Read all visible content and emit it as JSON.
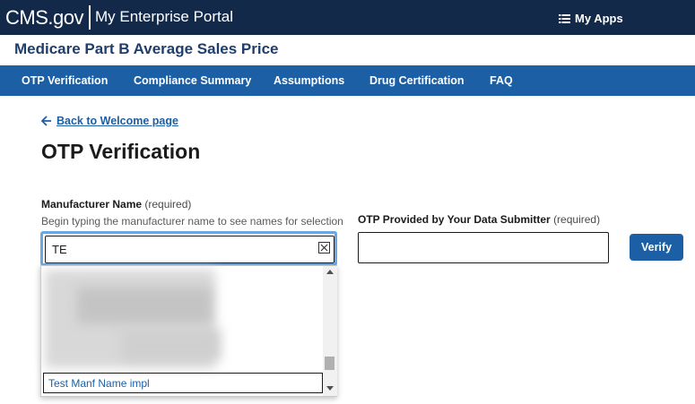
{
  "header": {
    "brand": "CMS.gov",
    "portal": "My Enterprise Portal",
    "my_apps": "My Apps",
    "my_apps_icon": "list-icon"
  },
  "app_title": "Medicare Part B Average Sales Price",
  "nav": {
    "items": [
      {
        "label": "OTP Verification"
      },
      {
        "label": "Compliance Summary"
      },
      {
        "label": "Assumptions"
      },
      {
        "label": "Drug Certification"
      },
      {
        "label": "FAQ"
      }
    ]
  },
  "back_link": "Back to Welcome page",
  "page_title": "OTP Verification",
  "manufacturer": {
    "label": "Manufacturer Name",
    "required": "(required)",
    "hint": "Begin typing the manufacturer name to see names for selection",
    "value": "TE",
    "options": [
      "Test Manf Name impl"
    ]
  },
  "otp": {
    "label": "OTP Provided by Your Data Submitter",
    "required": "(required)",
    "value": ""
  },
  "verify_button": "Verify",
  "colors": {
    "header_bg": "#12294a",
    "nav_bg": "#1c5fa5",
    "title": "#1f3e6b",
    "focus_ring": "#6aa8e4"
  }
}
